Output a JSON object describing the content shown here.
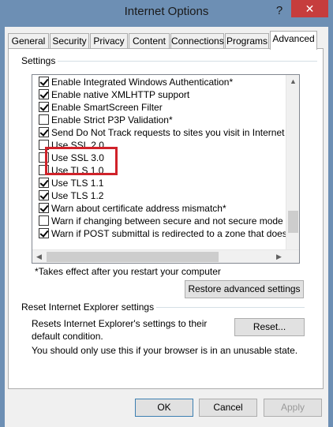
{
  "window": {
    "title": "Internet Options",
    "help_label": "?",
    "close_label": "✕"
  },
  "tabs": [
    {
      "label": "General"
    },
    {
      "label": "Security"
    },
    {
      "label": "Privacy"
    },
    {
      "label": "Content"
    },
    {
      "label": "Connections"
    },
    {
      "label": "Programs"
    },
    {
      "label": "Advanced",
      "active": true
    }
  ],
  "settings": {
    "group_label": "Settings",
    "items": [
      {
        "label": "Enable Integrated Windows Authentication*",
        "checked": true
      },
      {
        "label": "Enable native XMLHTTP support",
        "checked": true
      },
      {
        "label": "Enable SmartScreen Filter",
        "checked": true
      },
      {
        "label": "Enable Strict P3P Validation*",
        "checked": false
      },
      {
        "label": "Send Do Not Track requests to sites you visit in Internet E",
        "checked": true
      },
      {
        "label": "Use SSL 2.0",
        "checked": false
      },
      {
        "label": "Use SSL 3.0",
        "checked": false
      },
      {
        "label": "Use TLS 1.0",
        "checked": false
      },
      {
        "label": "Use TLS 1.1",
        "checked": true
      },
      {
        "label": "Use TLS 1.2",
        "checked": true
      },
      {
        "label": "Warn about certificate address mismatch*",
        "checked": true
      },
      {
        "label": "Warn if changing between secure and not secure mode",
        "checked": false
      },
      {
        "label": "Warn if POST submittal is redirected to a zone that does n",
        "checked": true
      }
    ],
    "footnote": "*Takes effect after you restart your computer",
    "restore_label": "Restore advanced settings",
    "highlight_color": "#d0222a"
  },
  "reset": {
    "group_label": "Reset Internet Explorer settings",
    "description": "Resets Internet Explorer's settings to their default condition.",
    "button_label": "Reset...",
    "note": "You should only use this if your browser is in an unusable state."
  },
  "footer": {
    "ok_label": "OK",
    "cancel_label": "Cancel",
    "apply_label": "Apply"
  }
}
